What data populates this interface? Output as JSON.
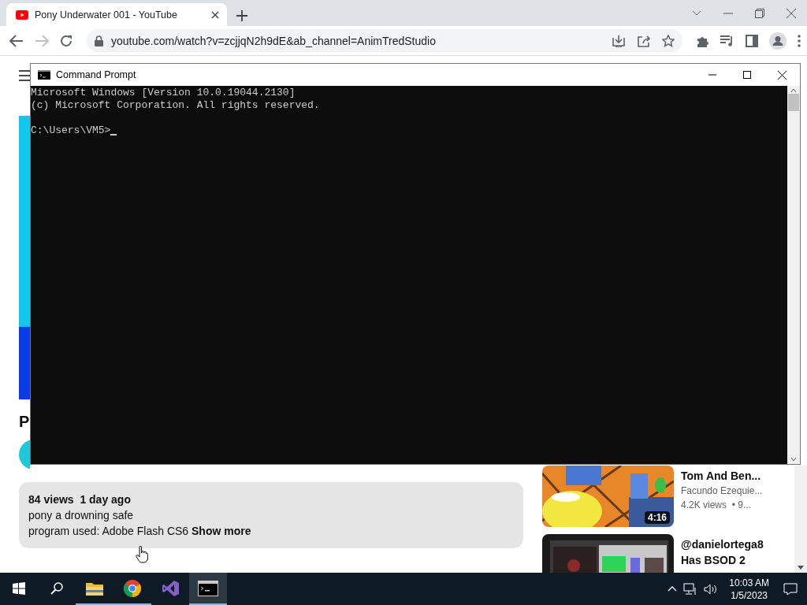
{
  "browser": {
    "tab": {
      "title": "Pony Underwater 001 - YouTube"
    },
    "address": "youtube.com/watch?v=zcjjqN2h9dE&ab_channel=AnimTredStudio",
    "forward_disabled": true
  },
  "page": {
    "video_title": "P",
    "description": {
      "meta": "84 views  1 day ago",
      "lines": [
        "pony a drowning safe",
        "program used: Adobe Flash CS6"
      ],
      "show_more": "Show more"
    },
    "related": [
      {
        "title_lines": [
          "Tom And Ben..."
        ],
        "channel": "Facundo Ezequie...",
        "stats": "4.2K views  • 9...",
        "duration": "4:16"
      },
      {
        "title_lines": [
          "@danielortega8",
          "Has BSOD 2"
        ]
      }
    ]
  },
  "console_window": {
    "title": "Command Prompt",
    "lines": [
      "Microsoft Windows [Version 10.0.19044.2130]",
      "(c) Microsoft Corporation. All rights reserved."
    ],
    "prompt": "C:\\Users\\VM5>"
  },
  "taskbar": {
    "apps": [
      {
        "kind": "explorer",
        "running": true,
        "selected": false
      },
      {
        "kind": "chrome",
        "running": true,
        "selected": false
      },
      {
        "kind": "studio",
        "running": false,
        "selected": false
      },
      {
        "kind": "console",
        "running": true,
        "selected": true
      }
    ],
    "time": "10:03 AM",
    "date": "1/5/2023"
  }
}
